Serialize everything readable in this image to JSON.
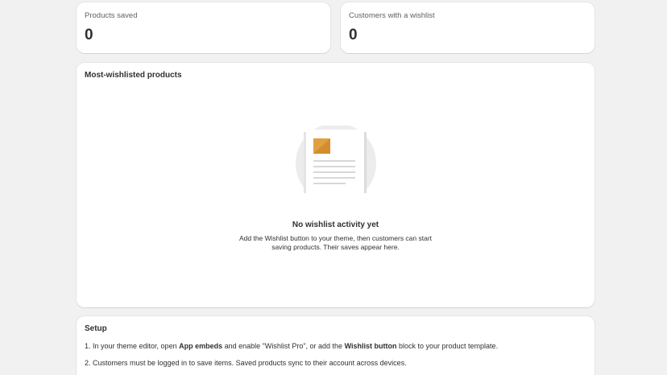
{
  "stats": {
    "products_saved": {
      "label": "Products saved",
      "value": "0"
    },
    "customers_with_wishlist": {
      "label": "Customers with a wishlist",
      "value": "0"
    }
  },
  "most_wishlisted": {
    "title": "Most-wishlisted products",
    "empty_state": {
      "illustration_icon": "document-placeholder-icon",
      "title": "No wishlist activity yet",
      "description": "Add the Wishlist button to your theme, then customers can start saving products. Their saves appear here."
    }
  },
  "setup": {
    "title": "Setup",
    "step1": {
      "prefix": "1. In your theme editor, open ",
      "bold1": "App embeds",
      "middle": " and enable \"Wishlist Pro\", or add the ",
      "bold2": "Wishlist button",
      "suffix": " block to your product template."
    },
    "step2": "2. Customers must be logged in to save items. Saved products sync to their account across devices."
  },
  "colors": {
    "background": "#f1f1f1",
    "card": "#ffffff",
    "accent_image": "#e0a040"
  }
}
